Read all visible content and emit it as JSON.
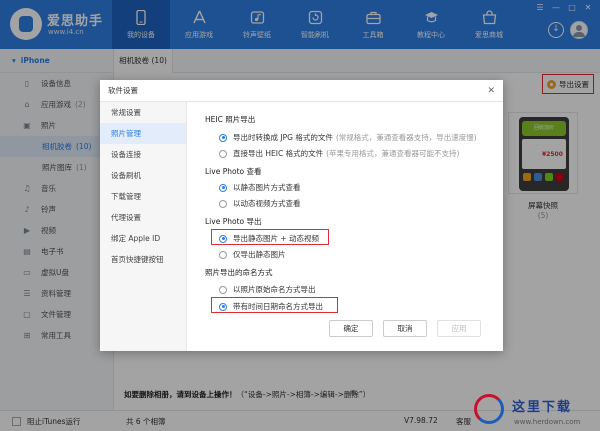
{
  "app": {
    "brand": "爱思助手",
    "url": "www.i4.cn"
  },
  "nav": [
    {
      "label": "我的设备",
      "icon": "phone-icon",
      "active": true
    },
    {
      "label": "应用游戏",
      "icon": "appstore-icon",
      "active": false
    },
    {
      "label": "铃声壁纸",
      "icon": "ringtone-icon",
      "active": false
    },
    {
      "label": "智能刷机",
      "icon": "flash-icon",
      "active": false
    },
    {
      "label": "工具箱",
      "icon": "toolbox-icon",
      "active": false
    },
    {
      "label": "教程中心",
      "icon": "tutorial-icon",
      "active": false
    },
    {
      "label": "爱思商城",
      "icon": "store-icon",
      "active": false
    }
  ],
  "window": {
    "controls": [
      "☰",
      "—",
      "□",
      "✕"
    ]
  },
  "sidebar": {
    "device": "iPhone",
    "items": [
      {
        "label": "设备信息",
        "count": "",
        "icon": "device-info-icon"
      },
      {
        "label": "应用游戏",
        "count": "(2)",
        "icon": "apps-icon"
      },
      {
        "label": "照片",
        "count": "",
        "icon": "photo-icon"
      },
      {
        "label": "相机胶卷",
        "count": "(10)",
        "icon": "",
        "sub": true,
        "active": true
      },
      {
        "label": "照片图库",
        "count": "(1)",
        "icon": "",
        "sub": true
      },
      {
        "label": "音乐",
        "count": "",
        "icon": "music-icon"
      },
      {
        "label": "铃声",
        "count": "",
        "icon": "bell-icon"
      },
      {
        "label": "视频",
        "count": "",
        "icon": "video-icon"
      },
      {
        "label": "电子书",
        "count": "",
        "icon": "ebook-icon"
      },
      {
        "label": "虚拟U盘",
        "count": "",
        "icon": "udisk-icon"
      },
      {
        "label": "资料管理",
        "count": "",
        "icon": "data-icon"
      },
      {
        "label": "文件管理",
        "count": "",
        "icon": "file-icon"
      },
      {
        "label": "常用工具",
        "count": "",
        "icon": "tools-icon"
      }
    ]
  },
  "main": {
    "tab": "相机胶卷 (10)",
    "export_button": "导出设置",
    "thumb": {
      "caption": "屏幕快照",
      "count": "(5)",
      "banner": "回收加价",
      "price": "¥2500"
    },
    "hint_bold": "如要删除相册，请到设备上操作！",
    "hint_rest": "（“设备->照片->相簿->编辑->删除”）",
    "hint_close": "⊗"
  },
  "status": {
    "itunes": "阻止iTunes运行",
    "total": "共 6 个相簿",
    "version": "V7.98.72",
    "extra": "客服"
  },
  "dialog": {
    "title": "软件设置",
    "close": "✕",
    "side": [
      "常规设置",
      "照片管理",
      "设备连接",
      "设备刷机",
      "下载管理",
      "代理设置",
      "绑定 Apple ID",
      "首页快捷键按钮"
    ],
    "active_side": 1,
    "sections": {
      "heic": "HEIC 照片导出",
      "live_view": "Live Photo 查看",
      "live_export": "Live Photo 导出",
      "naming": "照片导出的命名方式"
    },
    "options": {
      "heic_jpg": "导出时转换成 JPG 格式的文件",
      "heic_jpg_note": "(常规格式，兼通查看器支持，导出速度慢)",
      "heic_raw": "直接导出 HEIC 格式的文件",
      "heic_raw_note": "(苹果专用格式，兼通查看器可能不支持)",
      "view_still": "以静态图片方式查看",
      "view_video": "以动态视频方式查看",
      "export_both": "导出静态图片 + 动态视频",
      "export_still": "仅导出静态图片",
      "name_original": "以照片原始命名方式导出",
      "name_date": "带有时间日期命名方式导出"
    },
    "buttons": {
      "ok": "确定",
      "cancel": "取消",
      "apply": "应用"
    }
  },
  "watermark": {
    "text": "这里下载",
    "url": "www.herdown.com"
  }
}
